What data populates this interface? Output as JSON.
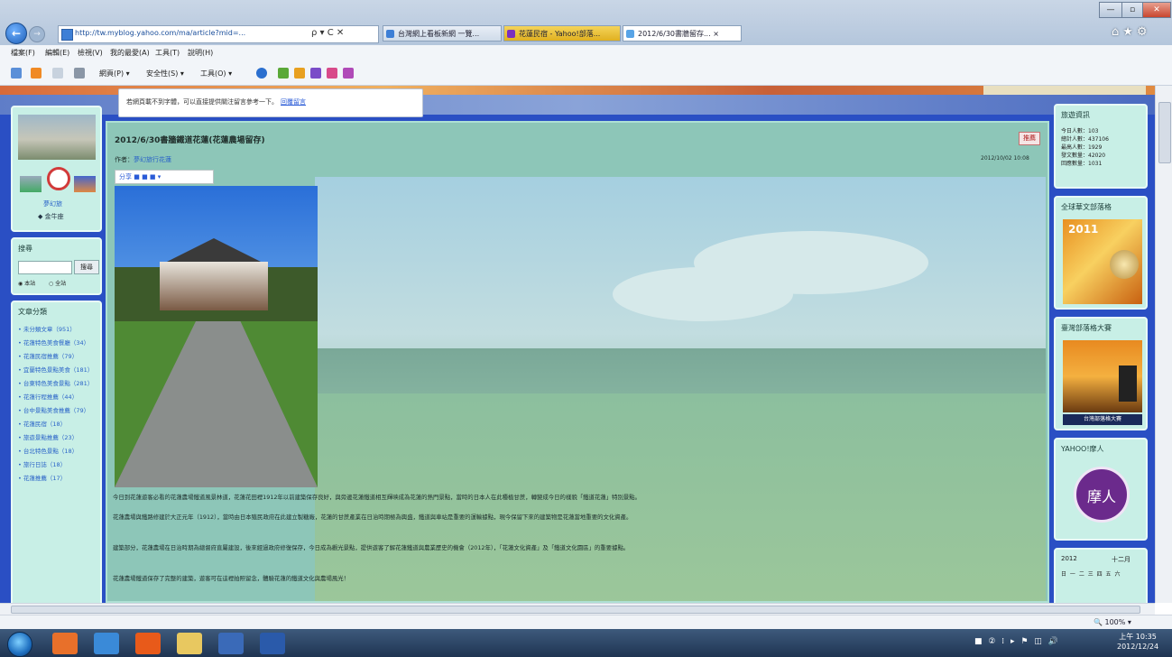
{
  "browser": {
    "back_label": "←",
    "forward_label": "→",
    "address": "http://tw.myblog.yahoo.com/ma/article?mid=...",
    "address_controls": "ρ ▾ C ✕",
    "tabs": [
      {
        "label": "台灣網上看板新網 一覽..."
      },
      {
        "label": "花蓮民宿 - Yahoo!部落..."
      },
      {
        "label": "2012/6/30書牆留存... ×"
      }
    ],
    "window_controls": {
      "minimize": "—",
      "restore": "▫",
      "close": "✕"
    },
    "tools_icons": "⌂★⚙",
    "menu": [
      "檔案(F)",
      "編輯(E)",
      "檢視(V)",
      "我的最愛(A)",
      "工具(T)",
      "說明(H)"
    ],
    "commands": [
      "網頁(P) ▾",
      "安全性(S) ▾",
      "工具(O) ▾"
    ],
    "zoom": "🔍 100%  ▾"
  },
  "notice": {
    "text": "若網頁載不到字體，可以直接提供關注留言參考一下。",
    "link": "回覆留言"
  },
  "sidebar_left": {
    "profile_name": "夢幻旅",
    "profile_badge": "◆ 金牛座",
    "search": {
      "title": "搜尋",
      "button": "搜尋",
      "option_a": "◉ 本站",
      "option_b": "○ 全站"
    },
    "categories": {
      "title": "文章分類",
      "items": [
        "• 未分類文章（951）",
        "• 花蓮特色美食餐廳（34）",
        "• 花蓮民宿推薦（79）",
        "• 宜蘭特色景點美食（181）",
        "• 台東特色美食景點（281）",
        "• 花蓮行程推薦（44）",
        "• 台中景點美食推薦（79）",
        "• 花蓮民宿（18）",
        "• 旅遊景點推薦（23）",
        "• 台北特色景點（18）",
        "• 旅行日誌（18）",
        "• 花蓮推薦（17）"
      ]
    }
  },
  "post": {
    "title": "2012/6/30書牆鐵道花蓮(花蓮農場留存)",
    "badge": "推薦",
    "author_label": "作者：",
    "author": "夢幻旅行花蓮",
    "date": "2012/10/02 10:08",
    "share": "分享 ■ ■ ■  ▾",
    "paragraphs": [
      "今日到花蓮遊客必看的花蓮農場鐵道風景林道，花蓮花田裡1912年以前建築保存良好，與旁邊花蓮鐵道相互輝映成為花蓮的熱門景點，當時的日本人在此種植甘蔗，轉變成今日的樣貌「鐵道花蓮」特別景點。",
      "  花蓮農場與鐵路修建於大正元年（1912），當時由日本殖民政府在此建立製糖廠，花蓮的甘蔗產業在日治時期極為興盛，鐵道與車站是重要的運輸據點，現今保留下來的建築物是花蓮當地重要的文化資產。",
      "  建築部分，花蓮農場在日治時期為總督府直屬建設，後來經過政府修復保存，今日成為觀光景點，提供遊客了解花蓮鐵道與農業歷史的機會（2012年），「花蓮文化資產」及「鐵道文化園區」的重要據點。",
      "  花蓮農場鐵道保存了完整的建築，遊客可在這裡拍照留念，體驗花蓮的鐵道文化與農場風光！"
    ]
  },
  "sidebar_right": {
    "stats": {
      "title": "旅遊資訊",
      "rows": [
        "今日人數：103",
        "總計人數：437106",
        "最高人數：1929",
        "發文數量：42020",
        "回應數量：1031"
      ]
    },
    "award": {
      "title": "全球華文部落格",
      "year": "2011"
    },
    "contest": {
      "title": "臺灣部落格大賽",
      "caption": "台灣部落格大賽"
    },
    "yahoo": {
      "title": "YAHOO!摩人",
      "logo_text": "摩人"
    },
    "calendar": {
      "year": "2012",
      "month": "十二月",
      "days": "日 一 二 三 四 五 六"
    }
  },
  "taskbar": {
    "tray_icons": "■ ② ⁞ ▸ ⚑ ◫ 🔊",
    "time": "上午 10:35",
    "date": "2012/12/24"
  }
}
